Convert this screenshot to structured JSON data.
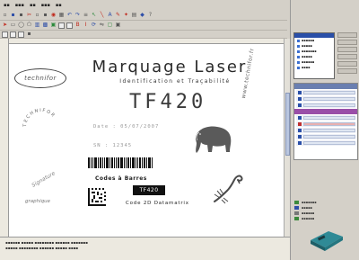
{
  "title": "Marquage Laser",
  "subtitle": "Identification et Traçabilité",
  "model": "TF420",
  "logo_text": "technifor",
  "date_line": "Date : 05/07/2007",
  "serial_line": "SN : 12345",
  "barcode_caption": "Codes à Barres",
  "datamatrix_caption": "Code 2D Datamatrix",
  "inverse_text": "TF420",
  "vertical_url": "www.technifor.fr",
  "circular_text": "TECHNIFOR",
  "script_text_1": "Signature",
  "script_text_2": "graphique",
  "icons": {
    "elephant": "elephant-graphic",
    "scorpion": "scorpion-graphic",
    "device": "laser-marker-device"
  },
  "colors": {
    "accent": "#2a4fa8",
    "toolbar_bg": "#d4d0c8"
  }
}
